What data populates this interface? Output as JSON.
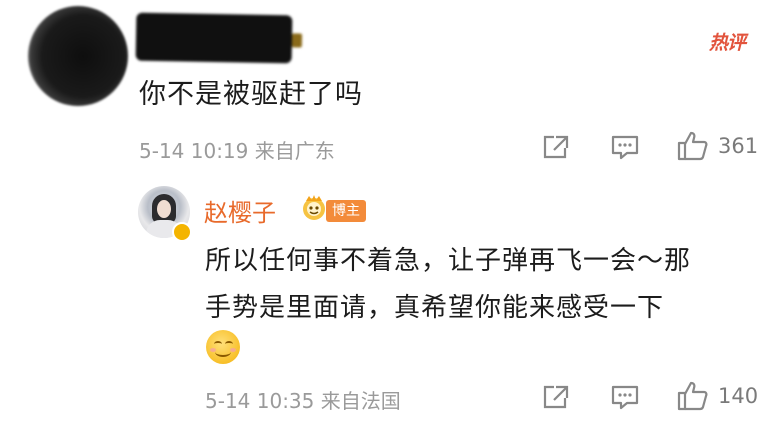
{
  "top_comment": {
    "text": "你不是被驱赶了吗",
    "meta": "5-14 10:19 来自广东",
    "likes": "361",
    "hot_badge": "热评"
  },
  "reply": {
    "author": "赵樱子",
    "badge": "博主",
    "text_line1": "所以任何事不着急，让子弹再飞一会～那",
    "text_line2": "手势是里面请，真希望你能来感受一下",
    "meta": "5-14 10:35 来自法国",
    "likes": "140"
  },
  "icons": {
    "share": "share-icon",
    "comment": "comment-icon",
    "like": "thumbs-up-icon",
    "emoji": "smile-emoji-icon",
    "vip": "vip-crown-icon"
  },
  "colors": {
    "author_name": "#e86a2b",
    "hot_badge": "#e2543d",
    "blogger_badge": "#f38b3a",
    "meta_text": "#9a9a9a"
  }
}
